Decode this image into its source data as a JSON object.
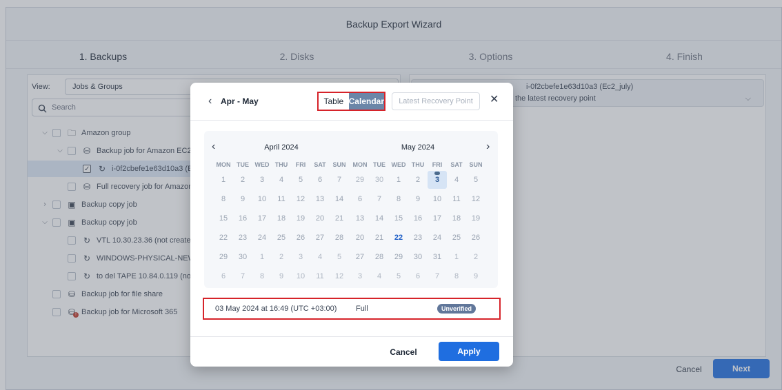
{
  "wizard": {
    "title": "Backup Export Wizard",
    "steps": [
      "1. Backups",
      "2. Disks",
      "3. Options",
      "4. Finish"
    ],
    "view_label": "View:",
    "view_value": "Jobs & Groups",
    "search_placeholder": "Search",
    "cancel_label": "Cancel",
    "next_label": "Next"
  },
  "tree": [
    {
      "label": "Amazon group",
      "icon": "folder-icon"
    },
    {
      "label": "Backup job for Amazon EC2",
      "icon": "backup-job-icon"
    },
    {
      "label": "i-0f2cbefe1e63d10a3 (E",
      "icon": "instance-icon"
    },
    {
      "label": "Full recovery job for Amazon",
      "icon": "recovery-job-icon"
    },
    {
      "label": "Backup copy job",
      "icon": "backup-copy-icon"
    },
    {
      "label": "Backup copy job",
      "icon": "backup-copy-icon"
    },
    {
      "label": "VTL 10.30.23.36 (not created",
      "icon": "instance-icon"
    },
    {
      "label": "WINDOWS-PHYSICAL-NEW",
      "icon": "instance-icon"
    },
    {
      "label": "to del TAPE 10.84.0.119 (not",
      "icon": "instance-icon"
    },
    {
      "label": "Backup job for file share",
      "icon": "backup-job-icon"
    },
    {
      "label": "Backup job for Microsoft 365",
      "icon": "backup-job-icon"
    }
  ],
  "right_panel": {
    "job_title_visible": "i-0f2cbefe1e63d10a3 (Ec2_july)",
    "point_select_visible": "the latest recovery point"
  },
  "modal": {
    "back_icon": "chevron-left-icon",
    "range_label": "Apr - May",
    "table_label": "Table",
    "calendar_label": "Calendar",
    "latest_label": "Latest Recovery Point",
    "close_icon": "close-icon",
    "cancel_label": "Cancel",
    "apply_label": "Apply",
    "selected_point": {
      "date": "03 May 2024 at 16:49 (UTC +03:00)",
      "type": "Full",
      "status": "Unverified"
    }
  },
  "calendar": {
    "weekdays": [
      "MON",
      "TUE",
      "WED",
      "THU",
      "FRI",
      "SAT",
      "SUN"
    ],
    "months": [
      {
        "title": "April 2024",
        "weeks": [
          [
            "1",
            "2",
            "3",
            "4",
            "5",
            "6",
            "7"
          ],
          [
            "8",
            "9",
            "10",
            "11",
            "12",
            "13",
            "14"
          ],
          [
            "15",
            "16",
            "17",
            "18",
            "19",
            "20",
            "21"
          ],
          [
            "22",
            "23",
            "24",
            "25",
            "26",
            "27",
            "28"
          ],
          [
            "29",
            "30",
            "1",
            "2",
            "3",
            "4",
            "5"
          ],
          [
            "6",
            "7",
            "8",
            "9",
            "10",
            "11",
            "12"
          ]
        ],
        "other_month_days": [
          [
            4,
            2
          ],
          [
            4,
            3
          ],
          [
            4,
            4
          ],
          [
            4,
            5
          ],
          [
            4,
            6
          ],
          [
            5,
            0
          ],
          [
            5,
            1
          ],
          [
            5,
            2
          ],
          [
            5,
            3
          ],
          [
            5,
            4
          ],
          [
            5,
            5
          ],
          [
            5,
            6
          ]
        ]
      },
      {
        "title": "May 2024",
        "weeks": [
          [
            "29",
            "30",
            "1",
            "2",
            "3",
            "4",
            "5"
          ],
          [
            "6",
            "7",
            "8",
            "9",
            "10",
            "11",
            "12"
          ],
          [
            "13",
            "14",
            "15",
            "16",
            "17",
            "18",
            "19"
          ],
          [
            "20",
            "21",
            "22",
            "23",
            "24",
            "25",
            "26"
          ],
          [
            "27",
            "28",
            "29",
            "30",
            "31",
            "1",
            "2"
          ],
          [
            "3",
            "4",
            "5",
            "6",
            "7",
            "8",
            "9"
          ]
        ],
        "other_month_days": [
          [
            0,
            0
          ],
          [
            0,
            1
          ],
          [
            4,
            5
          ],
          [
            4,
            6
          ],
          [
            5,
            0
          ],
          [
            5,
            1
          ],
          [
            5,
            2
          ],
          [
            5,
            3
          ],
          [
            5,
            4
          ],
          [
            5,
            5
          ],
          [
            5,
            6
          ]
        ],
        "marked_day": [
          0,
          4
        ],
        "today": [
          3,
          2
        ]
      }
    ]
  }
}
